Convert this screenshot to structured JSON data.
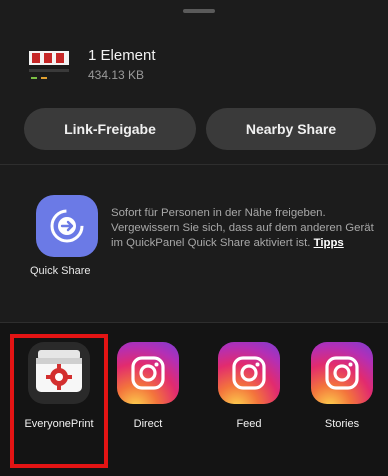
{
  "header": {
    "file_title": "1 Element",
    "file_size": "434.13 KB"
  },
  "actions": {
    "link_share": "Link-Freigabe",
    "nearby_share": "Nearby Share"
  },
  "quick_share": {
    "label": "Quick Share",
    "description": "Sofort für Personen in der Nähe freigeben. Vergewissern Sie sich, dass auf dem anderen Gerät im QuickPanel Quick Share aktiviert ist. ",
    "tips_link": "Tipps",
    "icon": "quick-share-icon",
    "color": "#6b7ae6"
  },
  "apps": [
    {
      "label": "EveryonePrint",
      "icon": "printer-icon",
      "highlighted": true
    },
    {
      "label": "Direct",
      "icon": "instagram-icon"
    },
    {
      "label": "Feed",
      "icon": "instagram-icon"
    },
    {
      "label": "Stories",
      "icon": "instagram-icon"
    }
  ],
  "colors": {
    "background": "#1c1c1c",
    "button": "#3a3a3a",
    "highlight": "#e31414"
  }
}
